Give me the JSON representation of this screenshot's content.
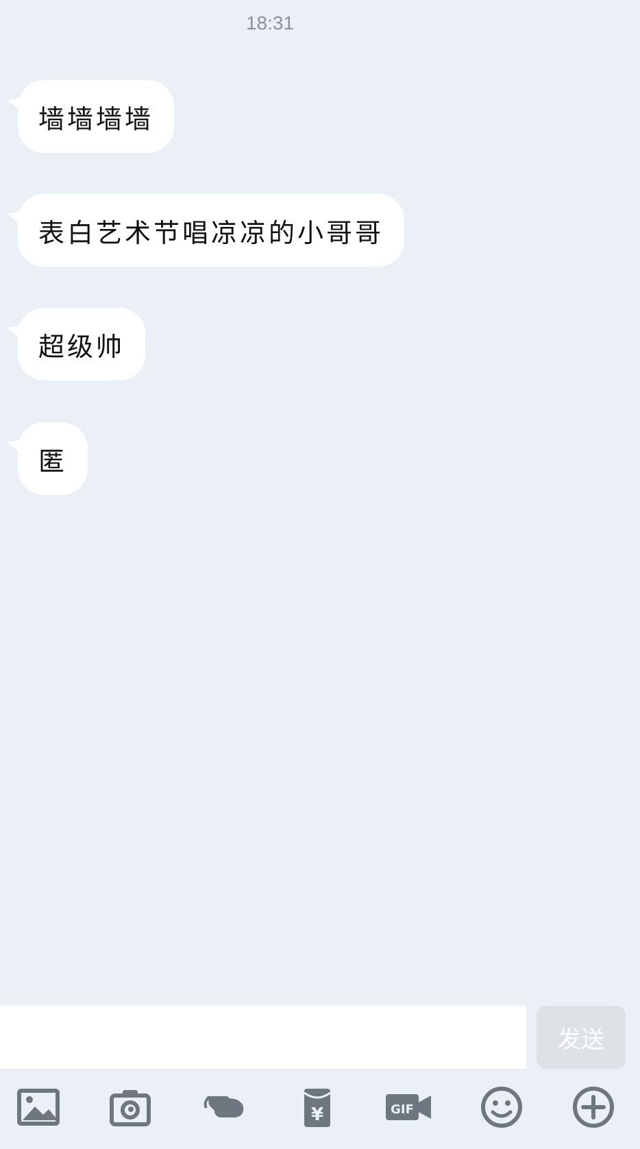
{
  "timestamp": "18:31",
  "messages": [
    {
      "text": "墙墙墙墙"
    },
    {
      "text": "表白艺术节唱凉凉的小哥哥"
    },
    {
      "text": "超级帅"
    },
    {
      "text": "匿"
    }
  ],
  "input": {
    "value": "",
    "placeholder": ""
  },
  "send_label": "发送",
  "toolbar_icons": [
    "image-icon",
    "camera-icon",
    "poke-hand-icon",
    "red-packet-icon",
    "gif-icon",
    "emoji-icon",
    "plus-icon"
  ],
  "colors": {
    "background": "#eaf0f5",
    "bubble": "#ffffff",
    "icon": "#6e7680",
    "send_button": "#dde2e6"
  }
}
